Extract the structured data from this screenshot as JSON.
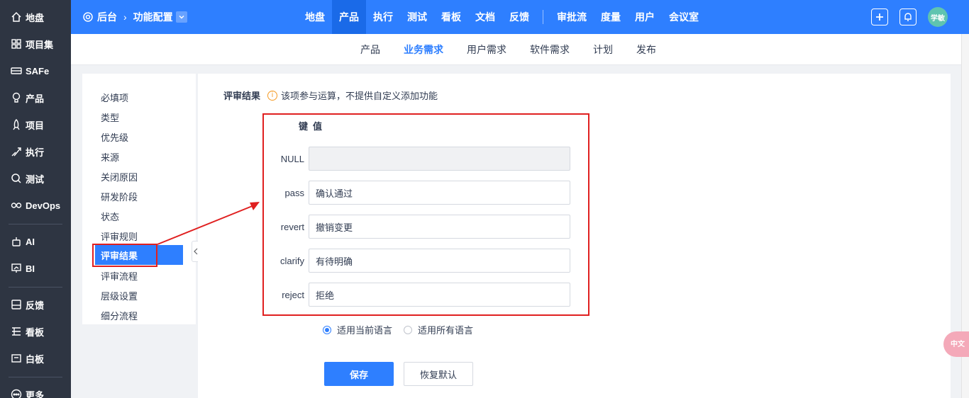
{
  "sidebar": {
    "items": [
      {
        "label": "地盘",
        "icon": "home-icon"
      },
      {
        "label": "项目集",
        "icon": "grid-icon"
      },
      {
        "label": "SAFe",
        "icon": "train-icon"
      },
      {
        "label": "产品",
        "icon": "bulb-icon"
      },
      {
        "label": "项目",
        "icon": "rocket-icon"
      },
      {
        "label": "执行",
        "icon": "run-icon"
      },
      {
        "label": "测试",
        "icon": "magnifier-icon"
      },
      {
        "label": "DevOps",
        "icon": "infinity-icon"
      },
      {
        "label": "AI",
        "icon": "robot-icon"
      },
      {
        "label": "BI",
        "icon": "presentation-icon"
      },
      {
        "label": "反馈",
        "icon": "feedback-icon"
      },
      {
        "label": "看板",
        "icon": "kanban-icon"
      },
      {
        "label": "白板",
        "icon": "whiteboard-icon"
      },
      {
        "label": "更多",
        "icon": "more-icon"
      }
    ]
  },
  "topbar": {
    "breadcrumb_root": "后台",
    "breadcrumb_current": "功能配置",
    "nav": [
      "地盘",
      "产品",
      "执行",
      "测试",
      "看板",
      "文档",
      "反馈"
    ],
    "nav2": [
      "审批流",
      "度量",
      "用户",
      "会议室"
    ],
    "active_nav": "产品",
    "avatar_text": "学敏"
  },
  "subnav": {
    "tabs": [
      "产品",
      "业务需求",
      "用户需求",
      "软件需求",
      "计划",
      "发布"
    ],
    "active": "业务需求"
  },
  "settings_menu": {
    "items": [
      "必填项",
      "类型",
      "优先级",
      "来源",
      "关闭原因",
      "研发阶段",
      "状态",
      "评审规则",
      "评审结果",
      "评审流程",
      "层级设置",
      "细分流程"
    ],
    "active": "评审结果"
  },
  "main": {
    "title": "评审结果",
    "hint": "该项参与运算，不提供自定义添加功能",
    "key_header": "键",
    "value_header": "值",
    "rows": [
      {
        "key": "NULL",
        "value": "",
        "disabled": true
      },
      {
        "key": "pass",
        "value": "确认通过"
      },
      {
        "key": "revert",
        "value": "撤销变更"
      },
      {
        "key": "clarify",
        "value": "有待明确"
      },
      {
        "key": "reject",
        "value": "拒绝"
      }
    ],
    "radio_current": "适用当前语言",
    "radio_all": "适用所有语言",
    "radio_selected": "适用当前语言",
    "save_label": "保存",
    "reset_label": "恢复默认"
  },
  "float_button": "中文",
  "colors": {
    "primary": "#2e7fff",
    "sidebar_bg": "#2e3542",
    "annotation": "#e02020",
    "hint_icon": "#f59a23"
  }
}
